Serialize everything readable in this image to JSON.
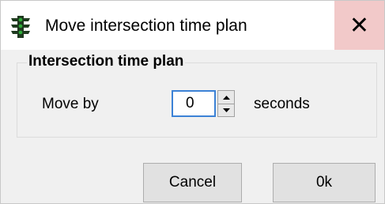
{
  "window": {
    "title": "Move intersection time plan",
    "icon": "traffic-light-icon",
    "close_glyph": "✕"
  },
  "group": {
    "legend": "Intersection time plan",
    "move_label": "Move by",
    "move_value": "0",
    "unit_label": "seconds"
  },
  "buttons": {
    "cancel_label": "Cancel",
    "ok_label": "0k"
  },
  "colors": {
    "close_hover": "#f2c9c9",
    "input_focus_border": "#3c82d6",
    "traffic_light_body": "#1f3a1f",
    "traffic_light_lamp": "#2fae3a"
  }
}
